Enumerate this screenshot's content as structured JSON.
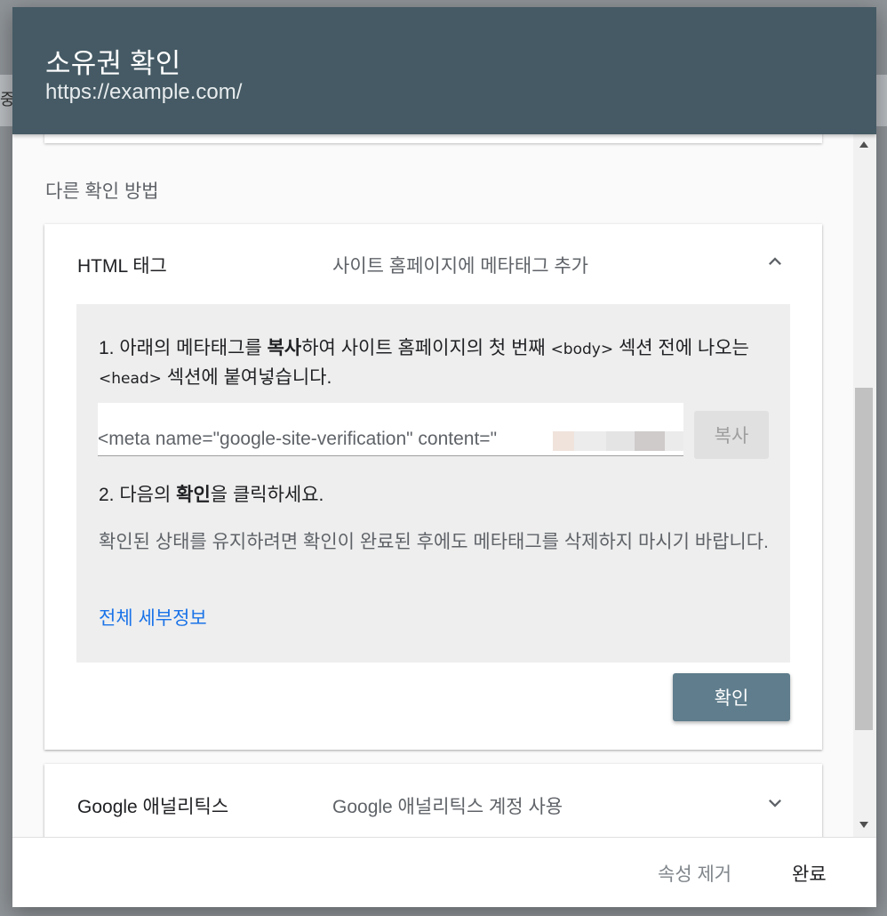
{
  "backdrop": {
    "partial_text": "중"
  },
  "dialog": {
    "title": "소유권 확인",
    "subtitle": "https://example.com/"
  },
  "section_label": "다른 확인 방법",
  "html_tag": {
    "title": "HTML 태그",
    "description": "사이트 홈페이지에 메타태그 추가",
    "step1": {
      "part1": "1. 아래의 메타태그를 ",
      "bold": "복사",
      "part2": "하여 사이트 홈페이지의 첫 번째 ",
      "code_body": "<body>",
      "part3": " 섹션 전에 나오는 ",
      "code_head": "<head>",
      "part4": " 섹션에 붙여넣습니다."
    },
    "meta_tag": "<meta name=\"google-site-verification\" content=\"",
    "copy_label": "복사",
    "step2": {
      "part1": "2. 다음의 ",
      "bold": "확인",
      "part2": "을 클릭하세요."
    },
    "note": "확인된 상태를 유지하려면 확인이 완료된 후에도 메타태그를 삭제하지 마시기 바랍니다.",
    "details_link": "전체 세부정보",
    "verify_label": "확인"
  },
  "google_analytics": {
    "title": "Google 애널리틱스",
    "description": "Google 애널리틱스 계정 사용"
  },
  "footer": {
    "remove_label": "속성 제거",
    "done_label": "완료"
  },
  "colors": {
    "header_bg": "#455a64",
    "verify_button": "#5f7d8c",
    "link": "#1a73e8"
  }
}
